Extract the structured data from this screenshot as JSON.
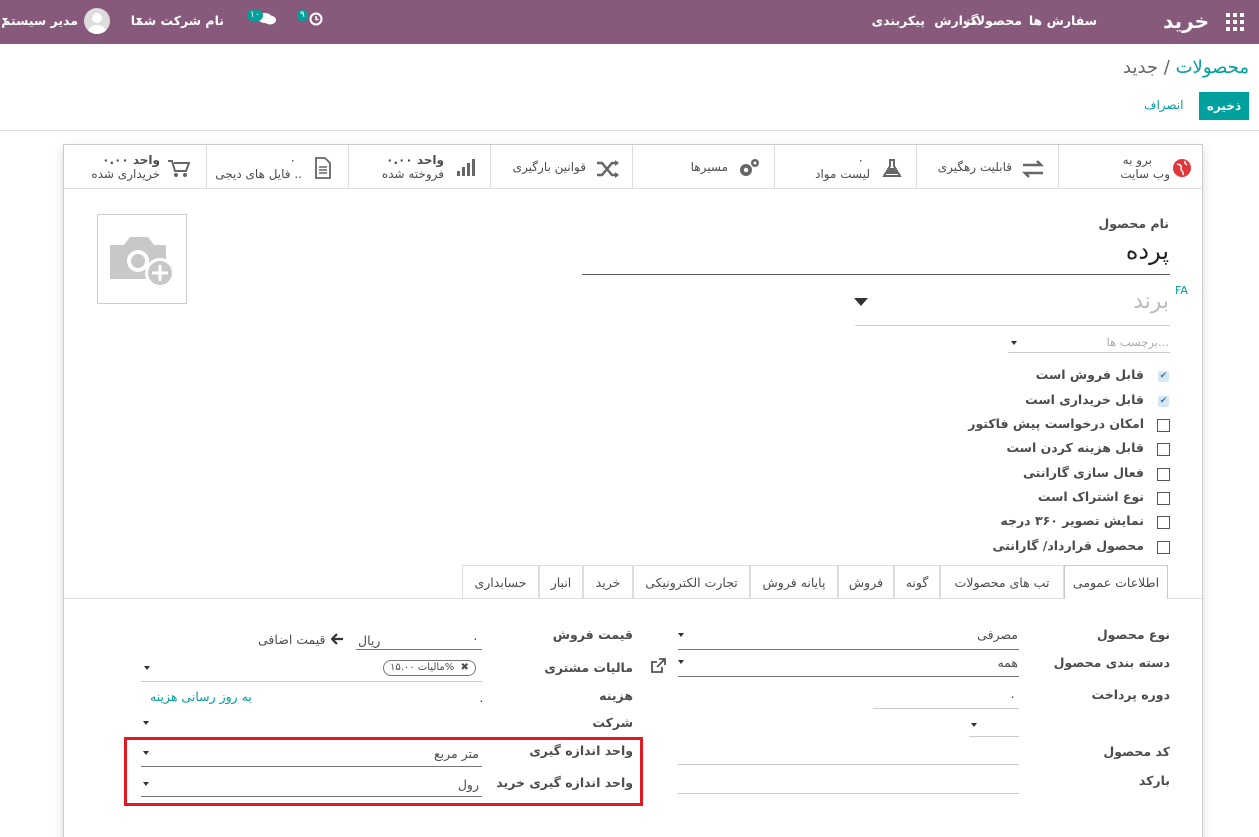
{
  "topbar": {
    "app_title": "خرید",
    "menu": [
      "سفارش ها",
      "محصولات",
      "گزارش",
      "پیکربندی"
    ],
    "activity_count": "۹",
    "messages_count": "۱۰",
    "company": "نام شرکت شما",
    "user": "مدیر سیستم"
  },
  "breadcrumb": {
    "parent": "محصولات",
    "separator": "/",
    "current": "جدید"
  },
  "actions": {
    "save": "ذخیره",
    "discard": "انصراف"
  },
  "smart_buttons": {
    "website": [
      "برو به",
      "وب سایت"
    ],
    "traceability": "قابلیت رهگیری",
    "bom": [
      "۰",
      "لیست مواد"
    ],
    "routes": "مسیرها",
    "putaway": "قوانین بارگیری",
    "sold": [
      "۰.۰۰ واحد",
      "فروخته شده"
    ],
    "files": [
      "۰",
      "فایل های دیجی .."
    ],
    "purchased": [
      "۰.۰۰ واحد",
      "خریداری شده"
    ]
  },
  "product": {
    "name_label": "نام محصول",
    "name": "پرده",
    "lang": "FA",
    "brand_placeholder": "برند",
    "tags_placeholder": "برچسب ها..."
  },
  "checkboxes": [
    {
      "label": "قابل فروش است",
      "checked": true
    },
    {
      "label": "قابل خریداری است",
      "checked": true
    },
    {
      "label": "امکان درخواست پیش فاکتور",
      "checked": false
    },
    {
      "label": "قابل هزینه کردن است",
      "checked": false
    },
    {
      "label": "فعال سازی گارانتی",
      "checked": false
    },
    {
      "label": "نوع اشتراک است",
      "checked": false
    },
    {
      "label": "نمایش تصویر ۳۶۰ درجه",
      "checked": false
    },
    {
      "label": "محصول قرارداد/ گارانتی",
      "checked": false
    }
  ],
  "tabs": [
    "اطلاعات عمومی",
    "تب های محصولات",
    "گونه",
    "فروش",
    "پایانه فروش",
    "تجارت الکترونیکی",
    "خرید",
    "انبار",
    "حسابداری"
  ],
  "general": {
    "type_label": "نوع محصول",
    "type_value": "مصرفی",
    "categ_label": "دسته بندی محصول",
    "categ_value": "همه",
    "payment_label": "دوره پرداخت",
    "payment_value": "۰",
    "ref_label": "کد محصول",
    "barcode_label": "بارکد",
    "price_label": "قیمت فروش",
    "price_value": "۰",
    "currency": "ریال",
    "extra_price": "قیمت اضافی",
    "tax_label": "مالیات مشتری",
    "tax_tag": "مالیات ۱۵.۰۰%",
    "cost_label": "هزینه",
    "cost_value": "۰",
    "update_cost": "به روز رسانی هزینه",
    "company_label": "شرکت",
    "uom_label": "واحد اندازه گیری",
    "uom_value": "متر مربع",
    "po_uom_label": "واحد اندازه گیری خرید",
    "po_uom_value": "رول"
  },
  "colors": {
    "brand": "#875a7b",
    "accent": "#00a09d",
    "highlight": "#e01b24"
  }
}
